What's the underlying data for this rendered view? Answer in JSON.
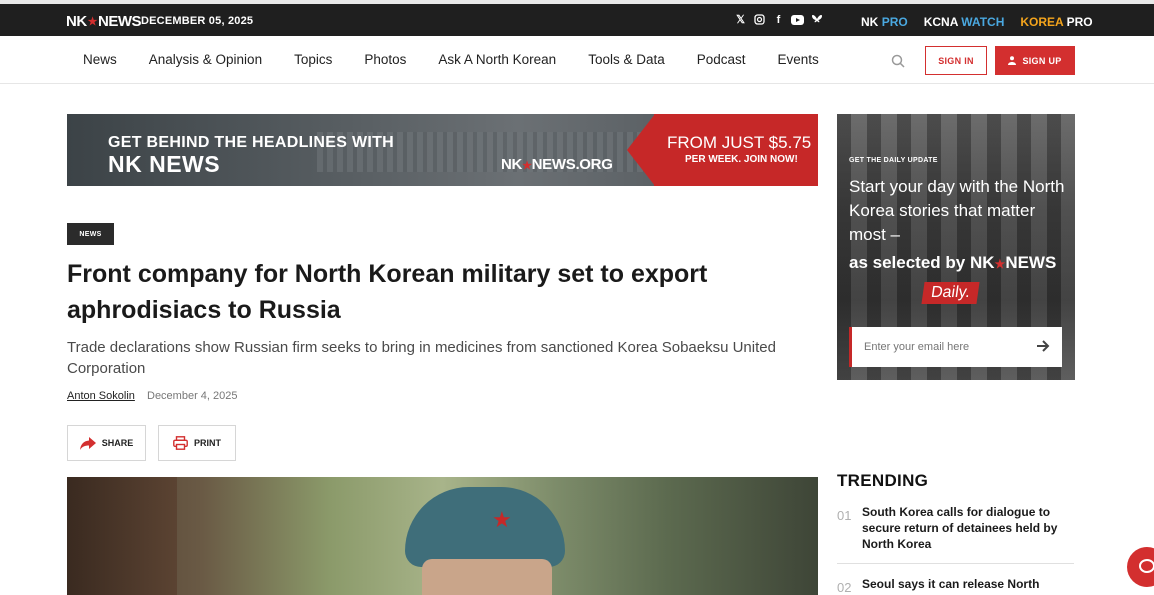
{
  "topbar": {
    "logo_left": "NK",
    "logo_right": "NEWS",
    "date": "DECEMBER 05, 2025",
    "social_icons": [
      "x-icon",
      "instagram-icon",
      "facebook-icon",
      "youtube-icon",
      "bluesky-icon"
    ],
    "brand_links": {
      "nkpro_a": "NK",
      "nkpro_b": "PRO",
      "kcna_a": "KCNA",
      "kcna_b": "WATCH",
      "korea_a": "KOREA",
      "korea_b": "PRO"
    }
  },
  "nav": {
    "items": [
      "News",
      "Analysis & Opinion",
      "Topics",
      "Photos",
      "Ask A North Korean",
      "Tools & Data",
      "Podcast",
      "Events"
    ],
    "signin": "SIGN IN",
    "signup": "SIGN UP"
  },
  "banner": {
    "line1": "GET BEHIND THE HEADLINES WITH",
    "line2": "NK NEWS",
    "org_a": "NK",
    "org_b": "NEWS.ORG",
    "price": "FROM JUST $5.75",
    "per_week": "PER WEEK. JOIN NOW!"
  },
  "article": {
    "tag": "NEWS",
    "headline": "Front company for North Korean military set to export aphrodisiacs to Russia",
    "subhead": "Trade declarations show Russian firm seeks to bring in medicines from sanctioned Korea Sobaeksu United Corporation",
    "author": "Anton Sokolin",
    "date": "December 4, 2025",
    "share": "SHARE",
    "print": "PRINT"
  },
  "promo": {
    "kicker": "GET THE DAILY UPDATE",
    "text": "Start your day with the North Korea stories that matter most –",
    "selected_by": "as selected by",
    "sel_a": "NK",
    "sel_b": "NEWS",
    "daily": "Daily.",
    "email_placeholder": "Enter your email here"
  },
  "trending": {
    "title": "TRENDING",
    "items": [
      {
        "num": "01",
        "title": "South Korea calls for dialogue to secure return of detainees held by North Korea"
      },
      {
        "num": "02",
        "title": "Seoul says it can release North"
      }
    ]
  },
  "colors": {
    "accent": "#d32f2f",
    "topbar": "#1f1f1f",
    "pro_blue": "#4aa8e0",
    "korea_orange": "#f4a41c"
  }
}
